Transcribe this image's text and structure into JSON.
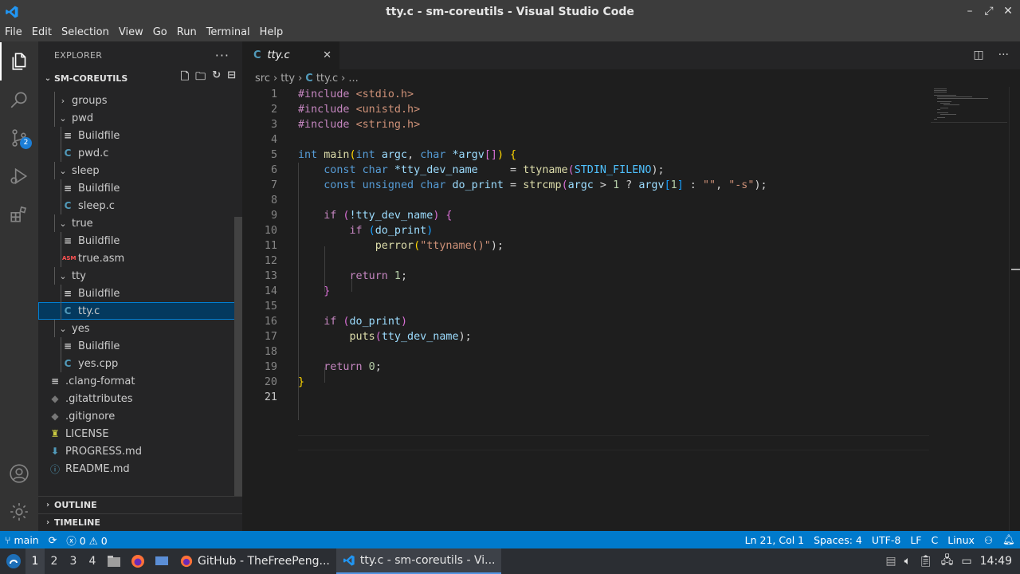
{
  "window": {
    "title": "tty.c - sm-coreutils - Visual Studio Code"
  },
  "menu": [
    "File",
    "Edit",
    "Selection",
    "View",
    "Go",
    "Run",
    "Terminal",
    "Help"
  ],
  "activity": {
    "scm_badge": "2"
  },
  "sidebar": {
    "header": "EXPLORER",
    "project": "SM-COREUTILS",
    "tree": [
      {
        "label": "groups",
        "type": "folder",
        "open": false,
        "depth": 1
      },
      {
        "label": "pwd",
        "type": "folder",
        "open": true,
        "depth": 1
      },
      {
        "label": "Buildfile",
        "type": "build",
        "depth": 2
      },
      {
        "label": "pwd.c",
        "type": "c",
        "depth": 2
      },
      {
        "label": "sleep",
        "type": "folder",
        "open": true,
        "depth": 1
      },
      {
        "label": "Buildfile",
        "type": "build",
        "depth": 2
      },
      {
        "label": "sleep.c",
        "type": "c",
        "depth": 2
      },
      {
        "label": "true",
        "type": "folder",
        "open": true,
        "depth": 1
      },
      {
        "label": "Buildfile",
        "type": "build",
        "depth": 2
      },
      {
        "label": "true.asm",
        "type": "asm",
        "depth": 2
      },
      {
        "label": "tty",
        "type": "folder",
        "open": true,
        "depth": 1
      },
      {
        "label": "Buildfile",
        "type": "build",
        "depth": 2
      },
      {
        "label": "tty.c",
        "type": "c",
        "depth": 2,
        "selected": true
      },
      {
        "label": "yes",
        "type": "folder",
        "open": true,
        "depth": 1
      },
      {
        "label": "Buildfile",
        "type": "build",
        "depth": 2
      },
      {
        "label": "yes.cpp",
        "type": "cpp",
        "depth": 2
      },
      {
        "label": ".clang-format",
        "type": "build",
        "depth": 0
      },
      {
        "label": ".gitattributes",
        "type": "git",
        "depth": 0
      },
      {
        "label": ".gitignore",
        "type": "git",
        "depth": 0
      },
      {
        "label": "LICENSE",
        "type": "license",
        "depth": 0
      },
      {
        "label": "PROGRESS.md",
        "type": "md",
        "depth": 0
      },
      {
        "label": "README.md",
        "type": "info",
        "depth": 0
      }
    ],
    "outline": "OUTLINE",
    "timeline": "TIMELINE"
  },
  "editor": {
    "tab": {
      "icon": "C",
      "label": "tty.c"
    },
    "breadcrumb": [
      "src",
      "tty",
      "C",
      "tty.c",
      "..."
    ],
    "line_numbers": [
      "1",
      "2",
      "3",
      "4",
      "5",
      "6",
      "7",
      "8",
      "9",
      "10",
      "11",
      "12",
      "13",
      "14",
      "15",
      "16",
      "17",
      "18",
      "19",
      "20",
      "21"
    ],
    "code": {
      "l1": {
        "a": "#include ",
        "b": "<stdio.h>"
      },
      "l2": {
        "a": "#include ",
        "b": "<unistd.h>"
      },
      "l3": {
        "a": "#include ",
        "b": "<string.h>"
      },
      "l5": {
        "k1": "int",
        "f": "main",
        "p1": "(",
        "k2": "int",
        "v1": "argc",
        "c": ", ",
        "k3": "char",
        "v2": " *argv",
        "b1": "[]",
        "p2": ")",
        "brace": " {"
      },
      "l6": {
        "k": "const char",
        "v": " *tty_dev_name",
        "eq": "     = ",
        "f": "ttyname",
        "p1": "(",
        "m": "STDIN_FILENO",
        "p2": ");"
      },
      "l7": {
        "k": "const unsigned char",
        "v": " do_print",
        "eq": " = ",
        "f": "strcmp",
        "p1": "(",
        "v2": "argc",
        "op": " > ",
        "n": "1",
        "q": " ? ",
        "v3": "argv",
        "b1": "[",
        "n2": "1",
        "b2": "]",
        "c": " : ",
        "s1": "\"\"",
        "c2": ", ",
        "s2": "\"-s\"",
        "p2": ");"
      },
      "l9": {
        "k": "if",
        "p1": " (",
        "v": "!tty_dev_name",
        "p2": ")",
        "brace": " {"
      },
      "l10": {
        "k": "if",
        "p1": " (",
        "v": "do_print",
        "p2": ")"
      },
      "l11": {
        "f": "perror",
        "p1": "(",
        "s": "\"ttyname()\"",
        "p2": ");"
      },
      "l13": {
        "k": "return",
        "n": " 1",
        "semi": ";"
      },
      "l14": {
        "brace": "}"
      },
      "l16": {
        "k": "if",
        "p1": " (",
        "v": "do_print",
        "p2": ")"
      },
      "l17": {
        "f": "puts",
        "p1": "(",
        "v": "tty_dev_name",
        "p2": ");"
      },
      "l19": {
        "k": "return",
        "n": " 0",
        "semi": ";"
      },
      "l20": {
        "brace": "}"
      }
    }
  },
  "status": {
    "branch": "main",
    "errors": "0",
    "warnings": "0",
    "position": "Ln 21, Col 1",
    "spaces": "Spaces: 4",
    "encoding": "UTF-8",
    "eol": "LF",
    "language": "C",
    "platform": "Linux"
  },
  "taskbar": {
    "workspaces": [
      "1",
      "2",
      "3",
      "4"
    ],
    "tasks": [
      {
        "label": "GitHub - TheFreePeng..."
      },
      {
        "label": "tty.c - sm-coreutils - Vi..."
      }
    ],
    "clock": "14:49"
  },
  "colors": {
    "accent": "#007acc",
    "selection": "#04395e",
    "c_icon": "#519aba"
  }
}
